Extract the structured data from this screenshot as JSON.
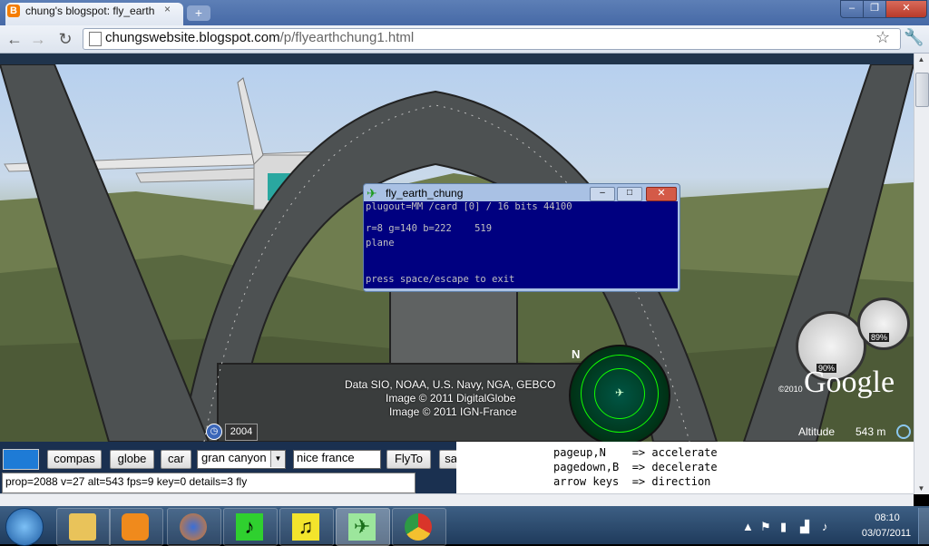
{
  "browser": {
    "tab_title": "chung's blogspot: fly_earth",
    "tab_favicon": "B",
    "tab_close": "×",
    "new_tab": "+",
    "url_host": "chungswebsite.blogspot.com",
    "url_path": "/p/flyearthchung1.html",
    "window_min": "–",
    "window_max": "❐",
    "window_close": "✕"
  },
  "console": {
    "title": "fly_earth_chung",
    "min": "–",
    "max": "□",
    "close": "✕",
    "lines": [
      "plugout=MM /card [0] / 16 bits 44100",
      "r=8 g=140 b=222    519",
      "plane",
      "press space/escape to exit"
    ]
  },
  "earth": {
    "attribution_1": "Data SIO, NOAA, U.S. Navy, NGA, GEBCO",
    "attribution_2": "Image © 2011 DigitalGlobe",
    "attribution_3": "Image © 2011 IGN-France",
    "year": "2004",
    "altitude_label": "Altitude",
    "altitude_value": "543 m",
    "logo": "Google",
    "copyright": "©2010",
    "compass_n": "N",
    "gauge_1_percent": "90%",
    "gauge_2_percent": "89%"
  },
  "controls": {
    "compas": "compas",
    "globe": "globe",
    "car": "car",
    "place_select": "gran canyon",
    "place_input": "nice france",
    "flyto": "FlyTo",
    "save": "save",
    "status": "prop=2088 v=27 alt=543 fps=9 key=0 details=3 fly",
    "swatch_color": "#1e7bd6"
  },
  "help": [
    "pageup,N    => accelerate",
    "pagedown,B  => decelerate",
    "arrow keys  => direction"
  ],
  "taskbar": {
    "time": "08:10",
    "date": "03/07/2011",
    "apps": [
      "explorer-icon",
      "media-player-icon",
      "firefox-icon",
      "music-icon",
      "music-note-icon",
      "fly-earth-icon",
      "chrome-icon"
    ]
  }
}
